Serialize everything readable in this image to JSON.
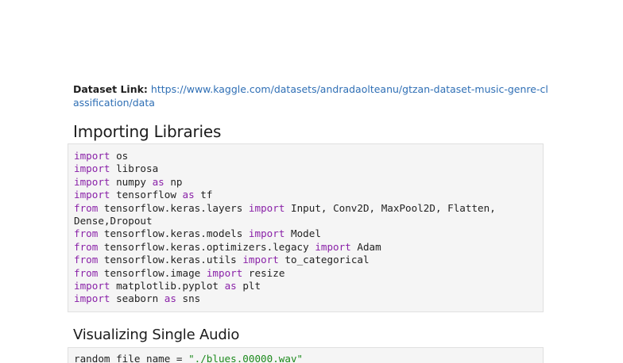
{
  "dataset": {
    "label": "Dataset Link:",
    "url": "https://www.kaggle.com/datasets/andradaolteanu/gtzan-dataset-music-genre-classification/data"
  },
  "sections": [
    {
      "title": "Importing Libraries",
      "code_lines": [
        [
          {
            "t": "import",
            "k": "kw"
          },
          {
            "t": " os"
          }
        ],
        [
          {
            "t": "import",
            "k": "kw"
          },
          {
            "t": " librosa"
          }
        ],
        [
          {
            "t": "import",
            "k": "kw"
          },
          {
            "t": " numpy "
          },
          {
            "t": "as",
            "k": "kw"
          },
          {
            "t": " np"
          }
        ],
        [
          {
            "t": "import",
            "k": "kw"
          },
          {
            "t": " tensorflow "
          },
          {
            "t": "as",
            "k": "kw"
          },
          {
            "t": " tf"
          }
        ],
        [
          {
            "t": "from",
            "k": "kw"
          },
          {
            "t": " tensorflow.keras.layers "
          },
          {
            "t": "import",
            "k": "kw"
          },
          {
            "t": " Input, Conv2D, MaxPool2D, Flatten,"
          }
        ],
        [
          {
            "t": "Dense,Dropout"
          }
        ],
        [
          {
            "t": "from",
            "k": "kw"
          },
          {
            "t": " tensorflow.keras.models "
          },
          {
            "t": "import",
            "k": "kw"
          },
          {
            "t": " Model"
          }
        ],
        [
          {
            "t": "from",
            "k": "kw"
          },
          {
            "t": " tensorflow.keras.optimizers.legacy "
          },
          {
            "t": "import",
            "k": "kw"
          },
          {
            "t": " Adam"
          }
        ],
        [
          {
            "t": "from",
            "k": "kw"
          },
          {
            "t": " tensorflow.keras.utils "
          },
          {
            "t": "import",
            "k": "kw"
          },
          {
            "t": " to_categorical"
          }
        ],
        [
          {
            "t": "from",
            "k": "kw"
          },
          {
            "t": " tensorflow.image "
          },
          {
            "t": "import",
            "k": "kw"
          },
          {
            "t": " resize"
          }
        ],
        [
          {
            "t": "import",
            "k": "kw"
          },
          {
            "t": " matplotlib.pyplot "
          },
          {
            "t": "as",
            "k": "kw"
          },
          {
            "t": " plt"
          }
        ],
        [
          {
            "t": "import",
            "k": "kw"
          },
          {
            "t": " seaborn "
          },
          {
            "t": "as",
            "k": "kw"
          },
          {
            "t": " sns"
          }
        ]
      ]
    },
    {
      "title": "Visualizing Single Audio",
      "code_lines": [
        [
          {
            "t": "random_file_name = "
          },
          {
            "t": "\"./blues.00000.wav\"",
            "k": "str"
          }
        ]
      ]
    }
  ]
}
